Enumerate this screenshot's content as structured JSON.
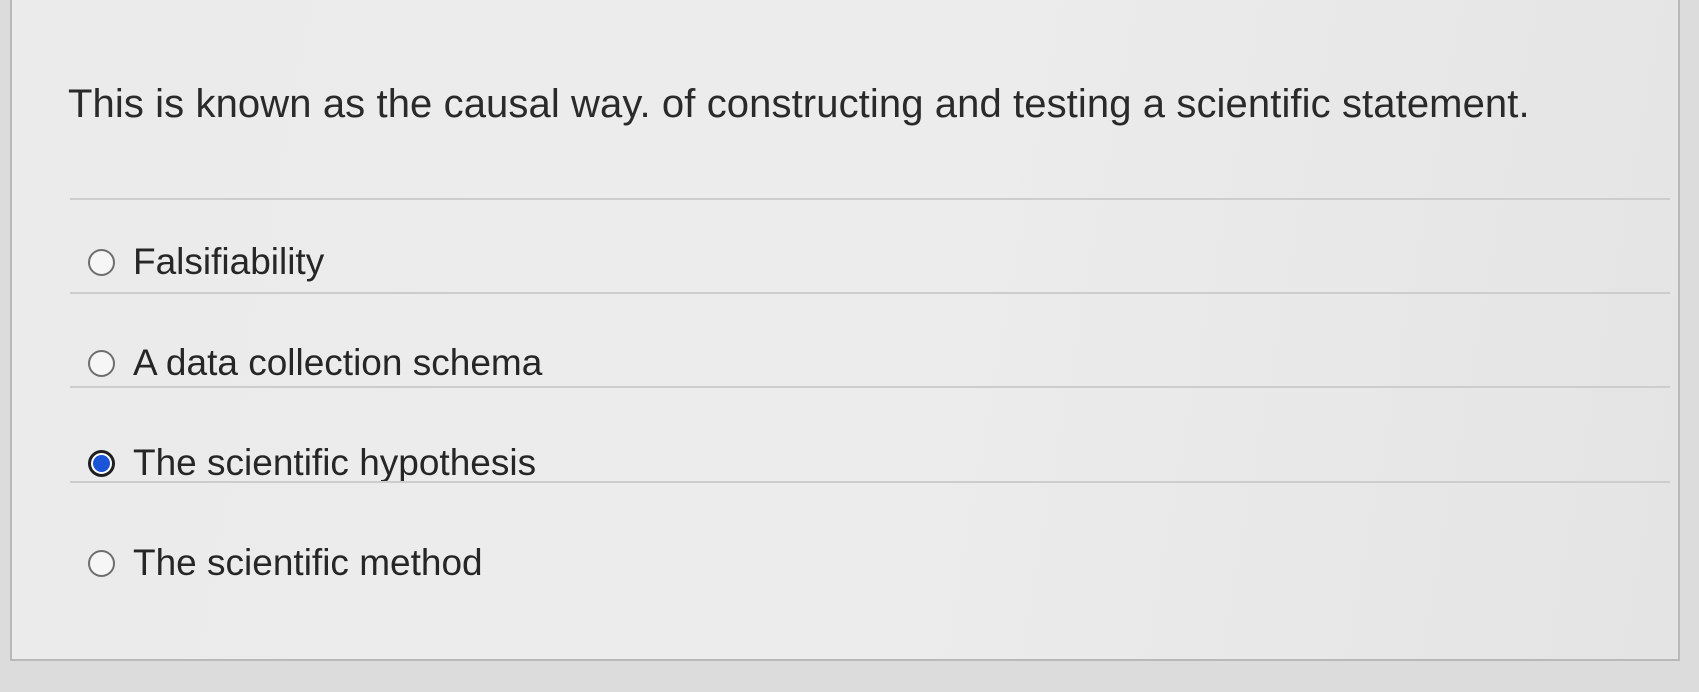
{
  "question": {
    "prompt": "This is known as the causal way. of constructing and testing a scientific statement."
  },
  "options": [
    {
      "label": "Falsifiability",
      "selected": false
    },
    {
      "label": "A data collection schema",
      "selected": false
    },
    {
      "label": "The scientific hypothesis",
      "selected": true
    },
    {
      "label": "The scientific method",
      "selected": false
    }
  ],
  "colors": {
    "selected_radio": "#1a55d8"
  }
}
